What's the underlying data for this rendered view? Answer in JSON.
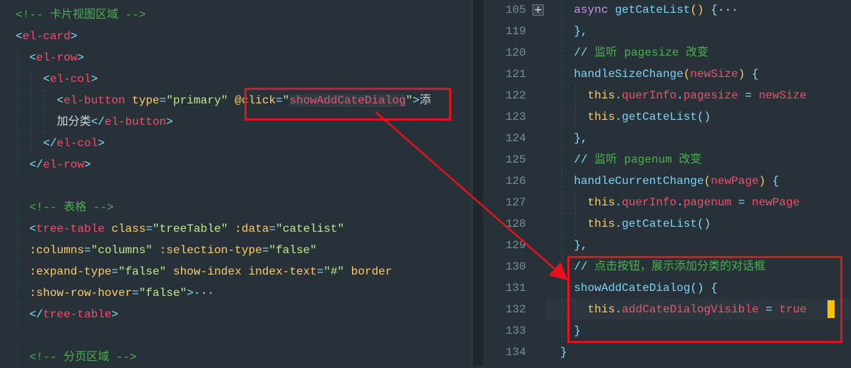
{
  "left_editor": {
    "lines": [
      {
        "indent": 0,
        "tokens": [
          [
            "<!-- 卡片视图区域 -->",
            "c"
          ]
        ]
      },
      {
        "indent": 0,
        "tokens": [
          [
            "<",
            "p"
          ],
          [
            "el-card",
            "t"
          ],
          [
            ">",
            "p"
          ]
        ]
      },
      {
        "indent": 1,
        "tokens": [
          [
            "<",
            "p"
          ],
          [
            "el-row",
            "t"
          ],
          [
            ">",
            "p"
          ]
        ]
      },
      {
        "indent": 2,
        "tokens": [
          [
            "<",
            "p"
          ],
          [
            "el-col",
            "t"
          ],
          [
            ">",
            "p"
          ]
        ]
      },
      {
        "indent": 3,
        "tokens": [
          [
            "<",
            "p"
          ],
          [
            "el-button",
            "t"
          ],
          [
            " ",
            "w"
          ],
          [
            "type",
            "a"
          ],
          [
            "=",
            "p"
          ],
          [
            "\"primary\"",
            "s"
          ],
          [
            " ",
            "w"
          ],
          [
            "@click",
            "a"
          ],
          [
            "=",
            "p"
          ],
          [
            "\"",
            "s"
          ],
          [
            "showAddCateDialog",
            "t"
          ],
          [
            "\"",
            "s"
          ],
          [
            ">",
            "p"
          ],
          [
            "添",
            "w"
          ]
        ]
      },
      {
        "indent": 3,
        "tokens": [
          [
            "加分类",
            "w"
          ],
          [
            "</",
            "p"
          ],
          [
            "el-button",
            "t"
          ],
          [
            ">",
            "p"
          ]
        ]
      },
      {
        "indent": 2,
        "tokens": [
          [
            "</",
            "p"
          ],
          [
            "el-col",
            "t"
          ],
          [
            ">",
            "p"
          ]
        ]
      },
      {
        "indent": 1,
        "tokens": [
          [
            "</",
            "p"
          ],
          [
            "el-row",
            "t"
          ],
          [
            ">",
            "p"
          ]
        ]
      },
      {
        "indent": 0,
        "tokens": []
      },
      {
        "indent": 1,
        "tokens": [
          [
            "<!-- 表格 -->",
            "c"
          ]
        ]
      },
      {
        "indent": 1,
        "tokens": [
          [
            "<",
            "p"
          ],
          [
            "tree-table",
            "t"
          ],
          [
            " ",
            "w"
          ],
          [
            "class",
            "a"
          ],
          [
            "=",
            "p"
          ],
          [
            "\"treeTable\"",
            "s"
          ],
          [
            " ",
            "w"
          ],
          [
            ":data",
            "a"
          ],
          [
            "=",
            "p"
          ],
          [
            "\"catelist\"",
            "s"
          ]
        ]
      },
      {
        "indent": 1,
        "tokens": [
          [
            ":columns",
            "a"
          ],
          [
            "=",
            "p"
          ],
          [
            "\"columns\"",
            "s"
          ],
          [
            " ",
            "w"
          ],
          [
            ":selection-type",
            "a"
          ],
          [
            "=",
            "p"
          ],
          [
            "\"false\"",
            "s"
          ]
        ]
      },
      {
        "indent": 1,
        "tokens": [
          [
            ":expand-type",
            "a"
          ],
          [
            "=",
            "p"
          ],
          [
            "\"false\"",
            "s"
          ],
          [
            " ",
            "w"
          ],
          [
            "show-index",
            "a"
          ],
          [
            " ",
            "w"
          ],
          [
            "index-text",
            "a"
          ],
          [
            "=",
            "p"
          ],
          [
            "\"#\"",
            "s"
          ],
          [
            " ",
            "w"
          ],
          [
            "border",
            "a"
          ]
        ]
      },
      {
        "indent": 1,
        "tokens": [
          [
            ":show-row-hover",
            "a"
          ],
          [
            "=",
            "p"
          ],
          [
            "\"false\"",
            "s"
          ],
          [
            ">",
            "p"
          ],
          [
            "···",
            "w"
          ]
        ]
      },
      {
        "indent": 1,
        "tokens": [
          [
            "</",
            "p"
          ],
          [
            "tree-table",
            "t"
          ],
          [
            ">",
            "p"
          ]
        ]
      },
      {
        "indent": 0,
        "tokens": []
      },
      {
        "indent": 1,
        "tokens": [
          [
            "<!-- 分页区域 -->",
            "c"
          ]
        ]
      }
    ]
  },
  "right_editor": {
    "current_line": "132",
    "lines": [
      {
        "num": "105",
        "folded": true,
        "indent": 1,
        "tokens": [
          [
            "async",
            "k"
          ],
          [
            " ",
            "w"
          ],
          [
            "getCateList",
            "f"
          ],
          [
            "()",
            "a"
          ],
          [
            " {",
            "p"
          ],
          [
            "···",
            "w"
          ]
        ]
      },
      {
        "num": "119",
        "indent": 1,
        "tokens": [
          [
            "},",
            "p"
          ]
        ]
      },
      {
        "num": "120",
        "indent": 1,
        "tokens": [
          [
            "// ",
            "p"
          ],
          [
            "监听 pagesize 改变",
            "c"
          ]
        ]
      },
      {
        "num": "121",
        "indent": 1,
        "tokens": [
          [
            "handleSizeChange",
            "f"
          ],
          [
            "(",
            "a"
          ],
          [
            "newSize",
            "v"
          ],
          [
            ")",
            "a"
          ],
          [
            " {",
            "p"
          ]
        ]
      },
      {
        "num": "122",
        "indent": 2,
        "tokens": [
          [
            "this",
            "a"
          ],
          [
            ".",
            "p"
          ],
          [
            "querInfo",
            "v"
          ],
          [
            ".",
            "p"
          ],
          [
            "pagesize",
            "v"
          ],
          [
            " = ",
            "p"
          ],
          [
            "newSize",
            "v"
          ]
        ]
      },
      {
        "num": "123",
        "indent": 2,
        "tokens": [
          [
            "this",
            "a"
          ],
          [
            ".",
            "p"
          ],
          [
            "getCateList",
            "f"
          ],
          [
            "()",
            "p"
          ]
        ]
      },
      {
        "num": "124",
        "indent": 1,
        "tokens": [
          [
            "},",
            "p"
          ]
        ]
      },
      {
        "num": "125",
        "indent": 1,
        "tokens": [
          [
            "// ",
            "p"
          ],
          [
            "监听 pagenum 改变",
            "c"
          ]
        ]
      },
      {
        "num": "126",
        "indent": 1,
        "tokens": [
          [
            "handleCurrentChange",
            "f"
          ],
          [
            "(",
            "a"
          ],
          [
            "newPage",
            "v"
          ],
          [
            ")",
            "a"
          ],
          [
            " {",
            "p"
          ]
        ]
      },
      {
        "num": "127",
        "indent": 2,
        "tokens": [
          [
            "this",
            "a"
          ],
          [
            ".",
            "p"
          ],
          [
            "querInfo",
            "v"
          ],
          [
            ".",
            "p"
          ],
          [
            "pagenum",
            "v"
          ],
          [
            " = ",
            "p"
          ],
          [
            "newPage",
            "v"
          ]
        ]
      },
      {
        "num": "128",
        "indent": 2,
        "tokens": [
          [
            "this",
            "a"
          ],
          [
            ".",
            "p"
          ],
          [
            "getCateList",
            "f"
          ],
          [
            "()",
            "p"
          ]
        ]
      },
      {
        "num": "129",
        "indent": 1,
        "tokens": [
          [
            "},",
            "p"
          ]
        ]
      },
      {
        "num": "130",
        "indent": 1,
        "tokens": [
          [
            "// ",
            "p"
          ],
          [
            "点击按钮，展示添加分类的对话框",
            "c"
          ]
        ]
      },
      {
        "num": "131",
        "indent": 1,
        "tokens": [
          [
            "showAddCateDialog",
            "f"
          ],
          [
            "()",
            "p"
          ],
          [
            " {",
            "p"
          ]
        ]
      },
      {
        "num": "132",
        "indent": 2,
        "tokens": [
          [
            "this",
            "a"
          ],
          [
            ".",
            "p"
          ],
          [
            "addCateDialogVisible",
            "v"
          ],
          [
            " = ",
            "p"
          ],
          [
            "true",
            "v"
          ]
        ]
      },
      {
        "num": "133",
        "indent": 1,
        "tokens": [
          [
            "}",
            "p"
          ]
        ]
      },
      {
        "num": "134",
        "indent": 0,
        "tokens": [
          [
            "}",
            "p"
          ]
        ]
      }
    ]
  },
  "colors": {
    "background": "#263238",
    "annotation": "#e8101c",
    "cursor": "#ffc107"
  }
}
